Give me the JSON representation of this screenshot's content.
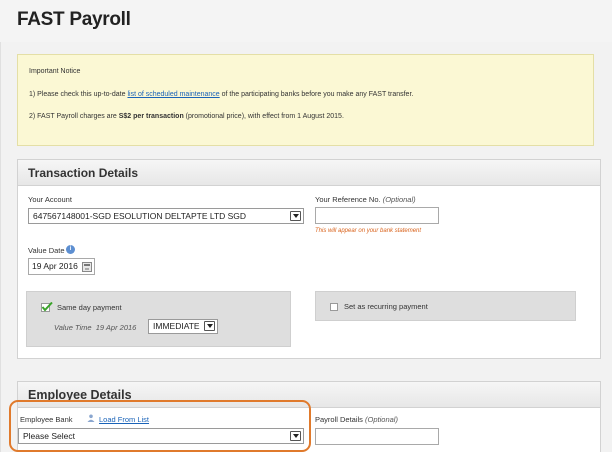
{
  "app": {
    "title": "FAST Payroll"
  },
  "notice": {
    "title": "Important Notice",
    "line1_prefix": "1) Please check this up-to-date ",
    "line1_link": "list of scheduled maintenance",
    "line1_suffix": " of the participating banks before you make any FAST transfer.",
    "line2_prefix": "2) FAST Payroll charges are ",
    "line2_bold": "S$2 per transaction",
    "line2_suffix": " (promotional price), with effect from 1 August 2015."
  },
  "transaction": {
    "header": "Transaction Details",
    "account_label": "Your Account",
    "account_value": "647567148001-SGD ESOLUTION DELTAPTE LTD SGD",
    "reference_label": "Your Reference No.",
    "reference_optional": "(Optional)",
    "reference_value": "",
    "reference_hint": "This will appear on your bank statement",
    "value_date_label": "Value Date",
    "value_date": "19 Apr 2016",
    "same_day_label": "Same day payment",
    "same_day_checked": true,
    "value_time_label": "Value Time",
    "value_time_date": "19 Apr 2016",
    "value_time_select": "IMMEDIATE",
    "recurring_label": "Set as recurring payment",
    "recurring_checked": false
  },
  "employee": {
    "header": "Employee Details",
    "bank_label": "Employee Bank",
    "load_link": "Load From List",
    "bank_select": "Please Select",
    "payroll_label": "Payroll Details",
    "payroll_optional": "(Optional)",
    "payroll_value": ""
  },
  "colors": {
    "accent_link": "#1a63b8",
    "highlight_border": "#e07a2c",
    "notice_bg": "#fbf8d4",
    "hint_text": "#d9621b",
    "check_green": "#3aa32a"
  }
}
